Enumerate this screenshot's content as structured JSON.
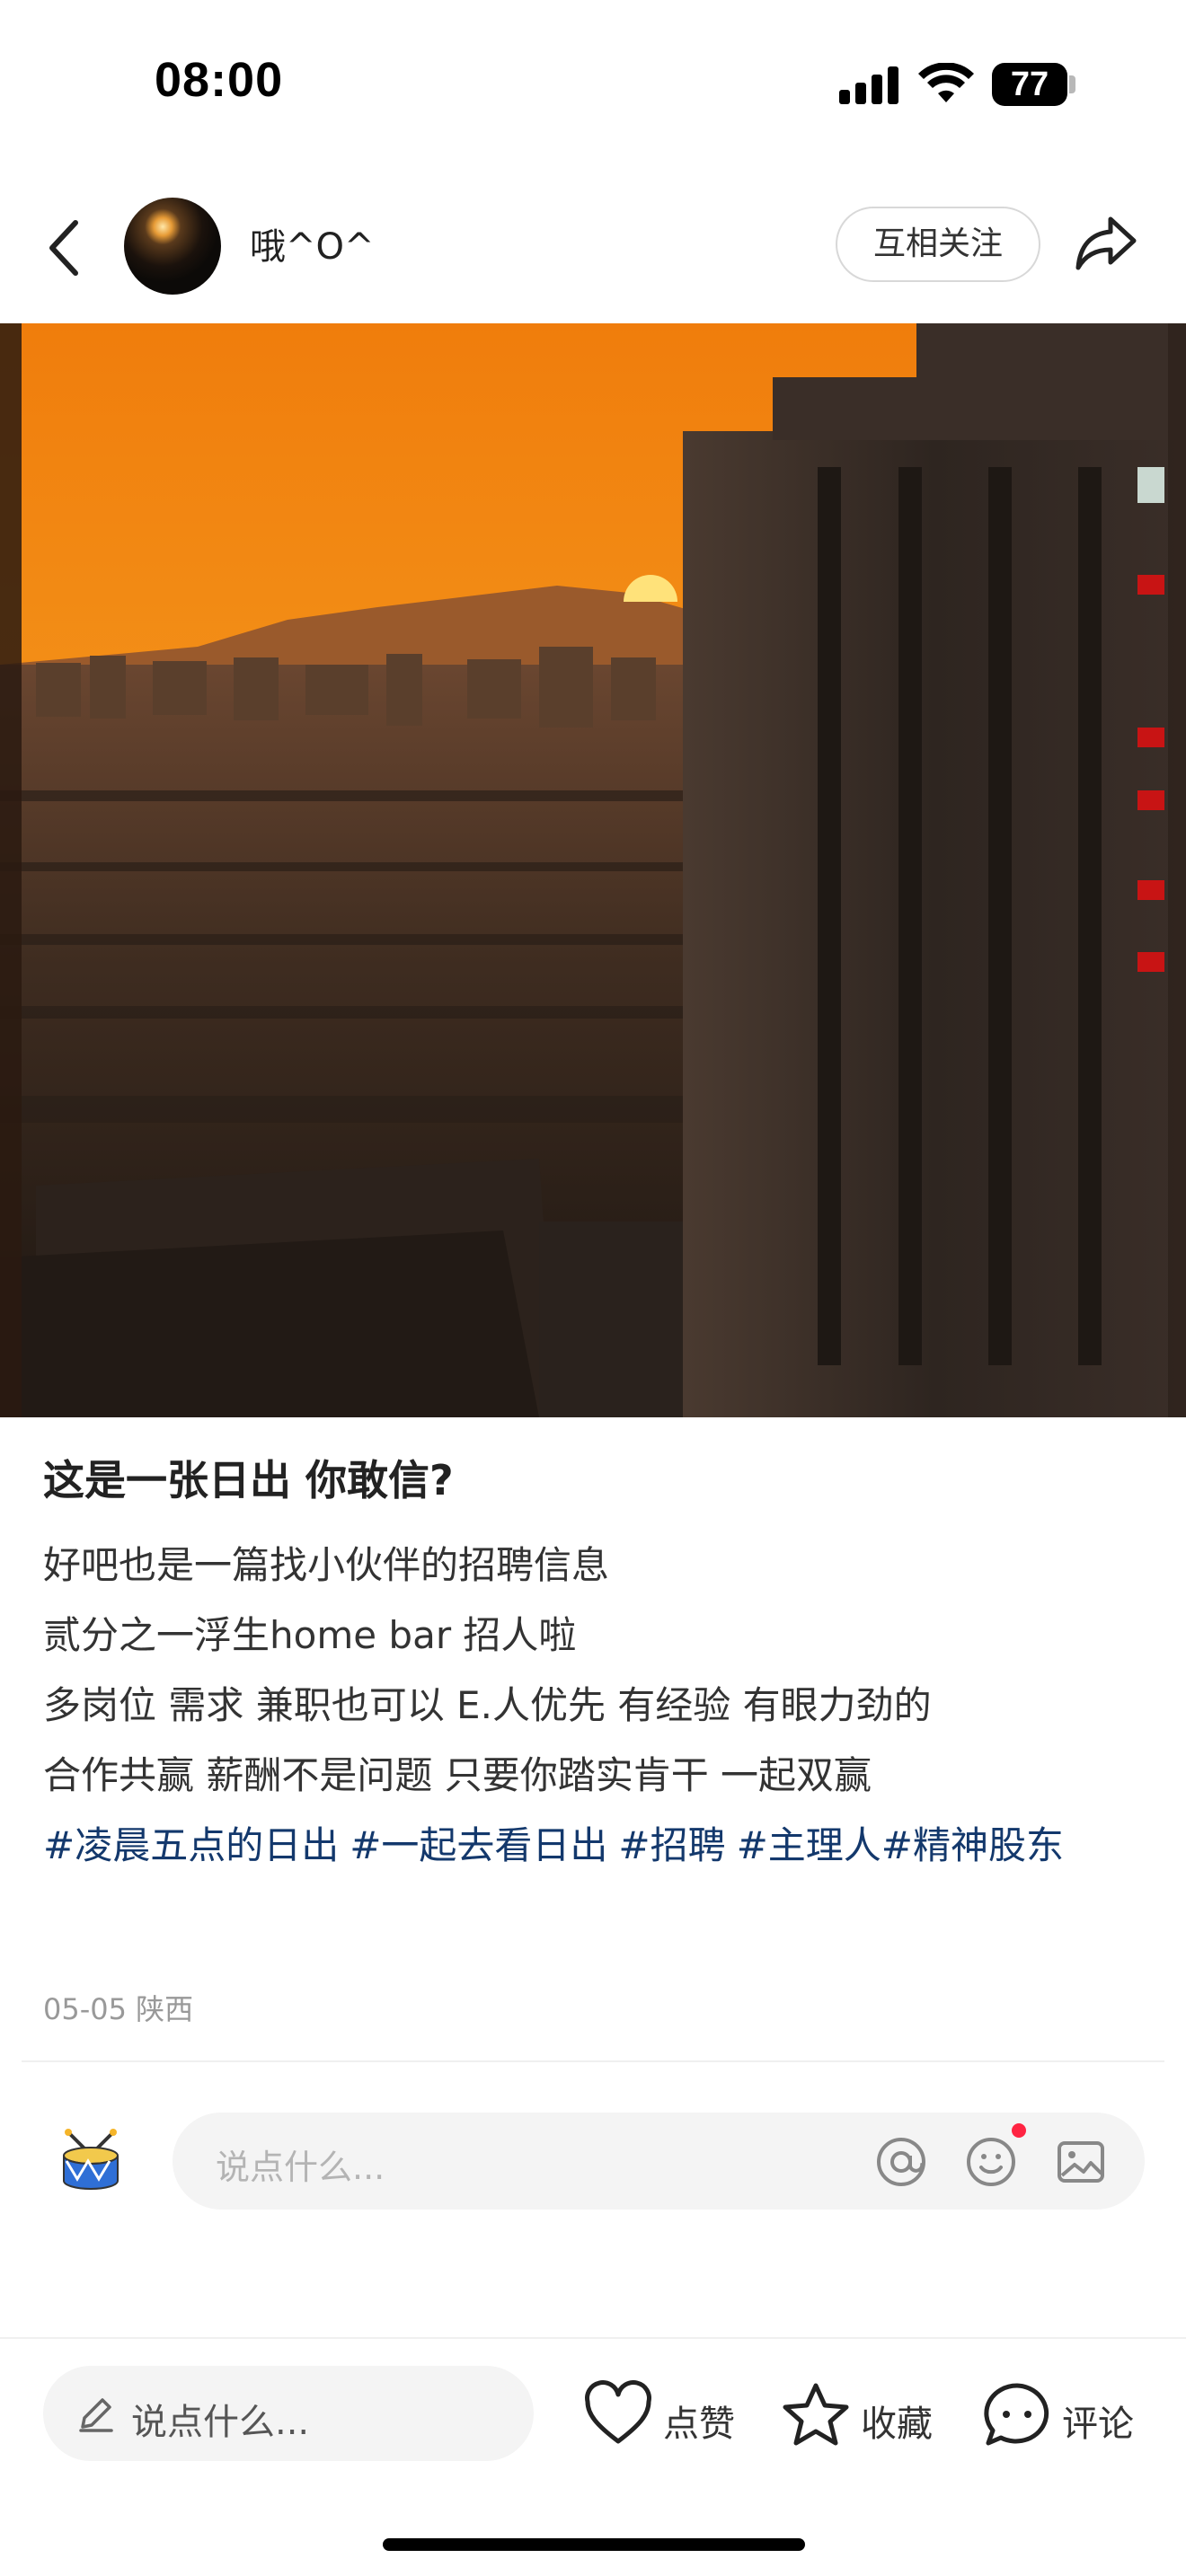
{
  "status_bar": {
    "time": "08:00",
    "battery": "77"
  },
  "header": {
    "username": "哦^O^",
    "follow_label": "互相关注"
  },
  "post": {
    "title": "这是一张日出 你敢信?",
    "lines": [
      "好吧也是一篇找小伙伴的招聘信息",
      "贰分之一浮生home bar 招人啦",
      "多岗位 需求 兼职也可以 E.人优先 有经验 有眼力劲的",
      "合作共赢 薪酬不是问题 只要你踏实肯干 一起双赢"
    ],
    "tags": [
      "#凌晨五点的日出",
      "#一起去看日出",
      "#招聘",
      "#主理人#精神股东"
    ],
    "date": "05-05",
    "location": "陕西"
  },
  "comment": {
    "placeholder": "说点什么..."
  },
  "bottom_bar": {
    "input_label": "说点什么...",
    "like_label": "点赞",
    "collect_label": "收藏",
    "comment_label": "评论"
  },
  "icons": [
    "signal-icon",
    "wifi-icon",
    "battery-icon",
    "back-arrow-icon",
    "share-icon",
    "drum-icon",
    "at-icon",
    "emoji-icon",
    "image-icon",
    "pencil-icon",
    "heart-icon",
    "star-icon",
    "comment-bubble-icon"
  ],
  "colors": {
    "tag": "#13386c",
    "notification_dot": "#ff2442",
    "sky_orange": "#f28a12"
  }
}
